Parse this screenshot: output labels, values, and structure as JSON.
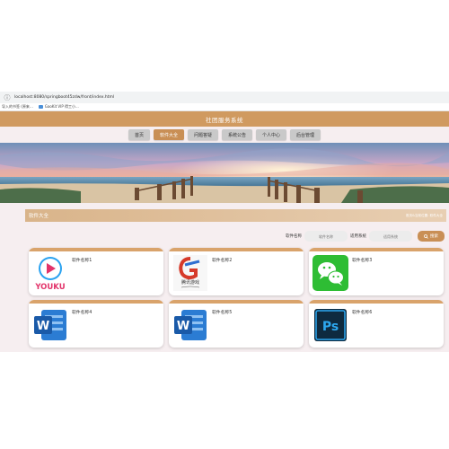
{
  "browser": {
    "url": "localhost:8080/springboot45zdw/front/index.html",
    "bookmarks": [
      "导入的书签 (原来…",
      "GaoKit VIP 得工小..."
    ]
  },
  "site": {
    "title": "社团服务系统",
    "nav": [
      "首页",
      "软件大全",
      "问题答疑",
      "系统公告",
      "个人中心",
      "后台管理"
    ],
    "active_nav": "软件大全"
  },
  "section": {
    "title": "软件大全",
    "breadcrumb": "首页&当前位置: 软件大全"
  },
  "search": {
    "name_label": "软件名称",
    "name_placeholder": "软件名称",
    "system_label": "适用系统",
    "system_placeholder": "适用系统",
    "button_label": "搜索",
    "button_icon": "search-icon"
  },
  "cards": [
    {
      "name": "软件名称1",
      "icon": "youku-icon"
    },
    {
      "name": "软件名称2",
      "icon": "tencent-game-icon"
    },
    {
      "name": "软件名称3",
      "icon": "wechat-icon"
    },
    {
      "name": "软件名称4",
      "icon": "word-icon"
    },
    {
      "name": "软件名称5",
      "icon": "word-icon"
    },
    {
      "name": "软件名称6",
      "icon": "photoshop-icon"
    }
  ],
  "icon_text": {
    "youku": "YOUKU",
    "word": "W",
    "photoshop": "Ps",
    "tencent": "腾讯游戏"
  },
  "colors": {
    "accent": "#c98f55",
    "header": "#d09a60",
    "card_top": "#d9a36b"
  }
}
